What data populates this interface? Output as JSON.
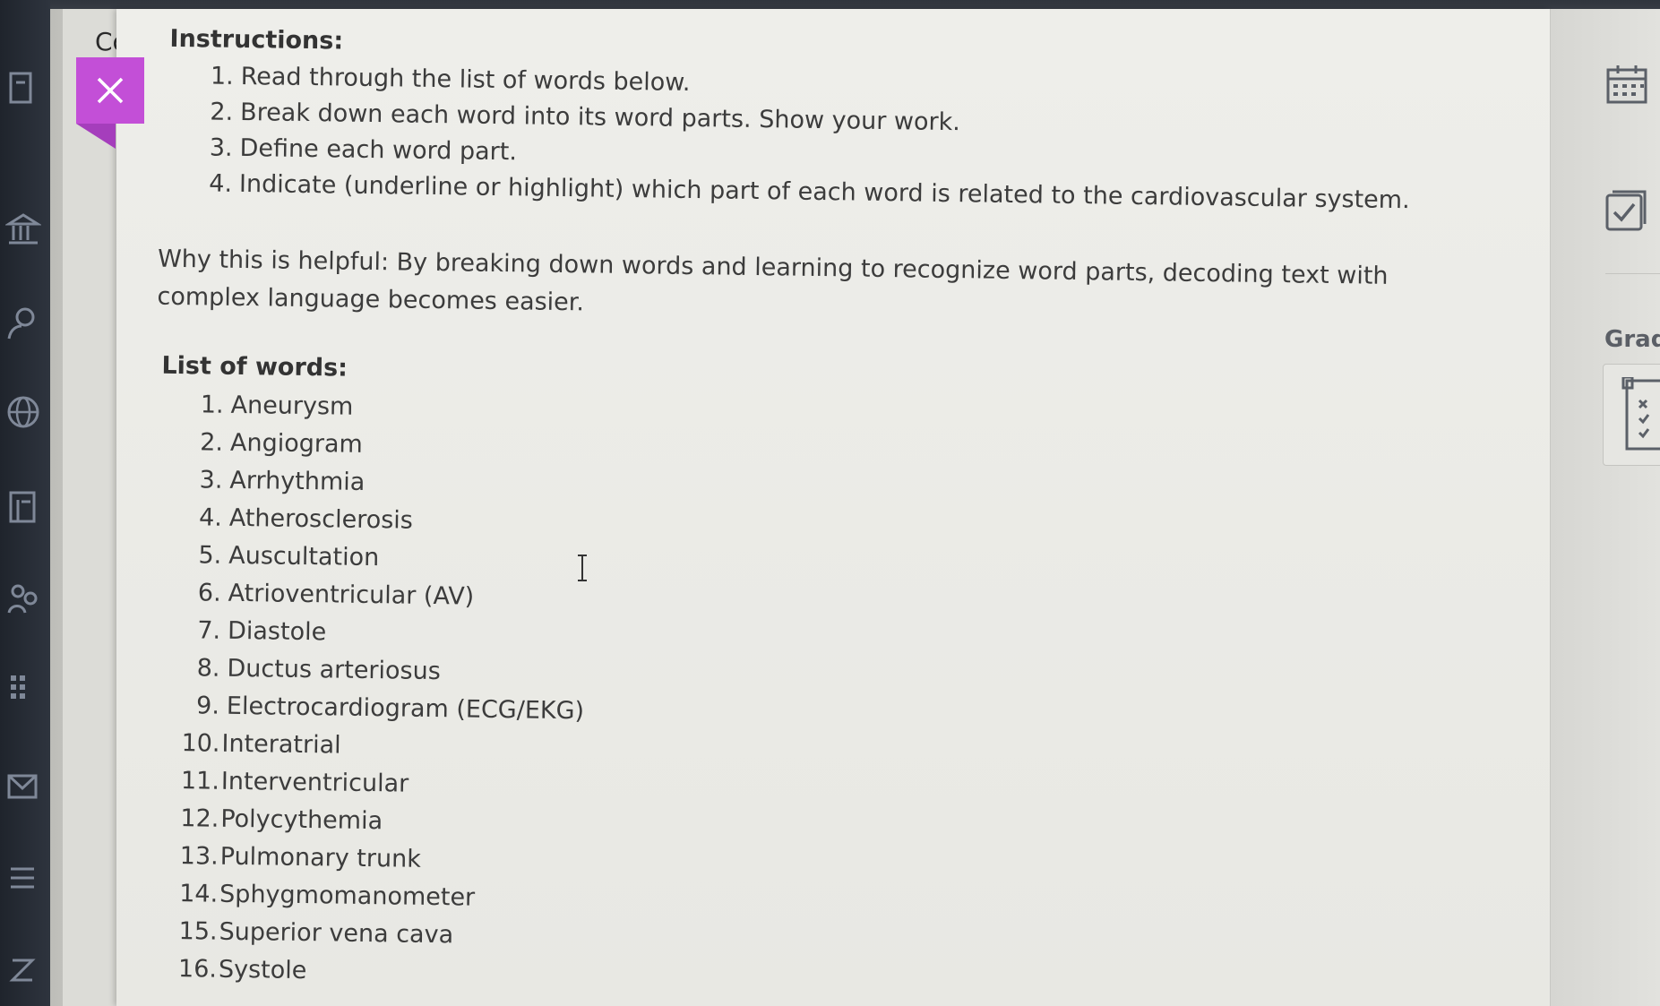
{
  "back_page": {
    "title_fragment": "Co"
  },
  "close": {
    "icon": "close-icon",
    "color": "#c34fd7"
  },
  "instructions": {
    "heading": "Instructions:",
    "steps": [
      {
        "num": "1.",
        "text": "Read through the list of words below."
      },
      {
        "num": "2.",
        "text": "Break down each word into its word parts. Show your work."
      },
      {
        "num": "3.",
        "text": "Define each word part."
      },
      {
        "num": "4.",
        "text": "Indicate (underline or highlight) which part of each word is related to the cardiovascular system."
      }
    ]
  },
  "why": {
    "text": "Why this is helpful: By breaking down words and learning to recognize word parts, decoding text with complex language becomes easier."
  },
  "words": {
    "heading": "List of words:",
    "items": [
      {
        "num": "1.",
        "text": "Aneurysm"
      },
      {
        "num": "2.",
        "text": "Angiogram"
      },
      {
        "num": "3.",
        "text": "Arrhythmia"
      },
      {
        "num": "4.",
        "text": "Atherosclerosis"
      },
      {
        "num": "5.",
        "text": "Auscultation"
      },
      {
        "num": "6.",
        "text": "Atrioventricular (AV)"
      },
      {
        "num": "7.",
        "text": "Diastole"
      },
      {
        "num": "8.",
        "text": "Ductus arteriosus"
      },
      {
        "num": "9.",
        "text": "Electrocardiogram (ECG/EKG)"
      },
      {
        "num": "10.",
        "text": "Interatrial"
      },
      {
        "num": "11.",
        "text": "Interventricular"
      },
      {
        "num": "12.",
        "text": "Polycythemia"
      },
      {
        "num": "13.",
        "text": "Pulmonary trunk"
      },
      {
        "num": "14.",
        "text": "Sphygmomanometer"
      },
      {
        "num": "15.",
        "text": "Superior vena cava"
      },
      {
        "num": "16.",
        "text": "Systole"
      }
    ]
  },
  "right_panel": {
    "calendar_icon": "calendar-icon",
    "checkbox_icon": "checklist-checkbox-icon",
    "grade_label": "Grad",
    "rubric_icon": "rubric-icon"
  },
  "left_rail": {
    "icons": [
      "document-icon",
      "institution-icon",
      "person-search-icon",
      "globe-icon",
      "calendar-grid-icon",
      "users-icon",
      "grid-icon",
      "mail-icon",
      "list-icon",
      "help-icon"
    ]
  }
}
